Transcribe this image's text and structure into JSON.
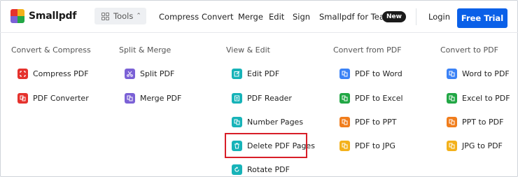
{
  "brand": {
    "name": "Smallpdf"
  },
  "header": {
    "tools_label": "Tools",
    "nav": [
      "Compress",
      "Convert",
      "Merge",
      "Edit",
      "Sign"
    ],
    "teams_label": "Smallpdf for Teams",
    "new_badge": "New",
    "login_label": "Login",
    "trial_label": "Free Trial"
  },
  "colors": {
    "accent": "#0a60e8",
    "red": "#e5322d",
    "purple": "#7b61d6",
    "teal": "#17b3b8",
    "blue": "#3b82f6",
    "green": "#22a745",
    "orange": "#f07d1c",
    "yellow": "#f3b11b",
    "highlight": "#d81e28"
  },
  "menu": {
    "columns": [
      {
        "title": "Convert & Compress",
        "items": [
          {
            "label": "Compress PDF",
            "icon": "compress-icon",
            "color": "#e5322d"
          },
          {
            "label": "PDF Converter",
            "icon": "converter-icon",
            "color": "#e5322d"
          }
        ]
      },
      {
        "title": "Split & Merge",
        "items": [
          {
            "label": "Split PDF",
            "icon": "scissors-icon",
            "color": "#7b61d6"
          },
          {
            "label": "Merge PDF",
            "icon": "merge-icon",
            "color": "#7b61d6"
          }
        ]
      },
      {
        "title": "View & Edit",
        "items": [
          {
            "label": "Edit PDF",
            "icon": "edit-icon",
            "color": "#17b3b8"
          },
          {
            "label": "PDF Reader",
            "icon": "reader-icon",
            "color": "#17b3b8"
          },
          {
            "label": "Number Pages",
            "icon": "number-pages-icon",
            "color": "#17b3b8"
          },
          {
            "label": "Delete PDF Pages",
            "icon": "trash-icon",
            "color": "#17b3b8"
          },
          {
            "label": "Rotate PDF",
            "icon": "rotate-icon",
            "color": "#17b3b8"
          }
        ]
      },
      {
        "title": "Convert from PDF",
        "items": [
          {
            "label": "PDF to Word",
            "icon": "word-icon",
            "color": "#3b82f6"
          },
          {
            "label": "PDF to Excel",
            "icon": "excel-icon",
            "color": "#22a745"
          },
          {
            "label": "PDF to PPT",
            "icon": "ppt-icon",
            "color": "#f07d1c"
          },
          {
            "label": "PDF to JPG",
            "icon": "jpg-icon",
            "color": "#f3b11b"
          }
        ]
      },
      {
        "title": "Convert to PDF",
        "items": [
          {
            "label": "Word to PDF",
            "icon": "word-icon",
            "color": "#3b82f6"
          },
          {
            "label": "Excel to PDF",
            "icon": "excel-icon",
            "color": "#22a745"
          },
          {
            "label": "PPT to PDF",
            "icon": "ppt-icon",
            "color": "#f07d1c"
          },
          {
            "label": "JPG to PDF",
            "icon": "jpg-icon",
            "color": "#f3b11b"
          }
        ]
      }
    ]
  }
}
